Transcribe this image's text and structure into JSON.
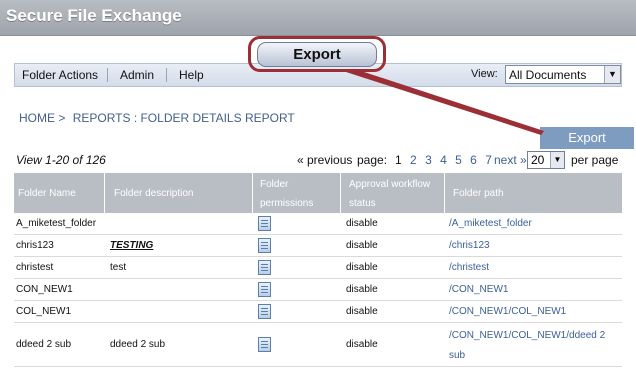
{
  "app": {
    "title": "Secure File Exchange"
  },
  "callout": {
    "label": "Export"
  },
  "menu": {
    "items": [
      {
        "label": "Folder Actions"
      },
      {
        "label": "Admin"
      },
      {
        "label": "Help"
      }
    ],
    "view_label": "View:",
    "view_selected": "All Documents"
  },
  "breadcrumb": {
    "home": "HOME >",
    "current": "REPORTS : FOLDER DETAILS REPORT"
  },
  "export_button": "Export",
  "pager": {
    "view_count": "View 1-20  of  126",
    "previous": "« previous",
    "page_label": "page:",
    "pages": [
      "1",
      "2",
      "3",
      "4",
      "5",
      "6",
      "7"
    ],
    "next": "next »",
    "per_page_value": "20",
    "per_page_label": "per page"
  },
  "table": {
    "columns": {
      "folder_name": "Folder Name",
      "folder_description": "Folder description",
      "folder_permissions_1": "Folder",
      "folder_permissions_2": "permissions",
      "approval_1": "Approval workflow",
      "approval_2": "status",
      "folder_path": "Folder path"
    },
    "rows": [
      {
        "name": "A_miketest_folder",
        "description": "",
        "status": "disable",
        "path": "/A_miketest_folder"
      },
      {
        "name": "chris123",
        "description": "TESTING",
        "status": "disable",
        "path": "/chris123"
      },
      {
        "name": "christest",
        "description": "test",
        "status": "disable",
        "path": "/christest"
      },
      {
        "name": "CON_NEW1",
        "description": "",
        "status": "disable",
        "path": "/CON_NEW1"
      },
      {
        "name": "COL_NEW1",
        "description": "",
        "status": "disable",
        "path": "/CON_NEW1/COL_NEW1"
      },
      {
        "name": "ddeed 2 sub",
        "description": "ddeed 2 sub",
        "status": "disable",
        "path": "/CON_NEW1/COL_NEW1/ddeed 2 sub"
      }
    ]
  },
  "colors": {
    "accent": "#9b2f35",
    "header_bg": "#b9bdc4",
    "link": "#3b5f97",
    "export_bg": "#7e9bc0"
  },
  "icons": {
    "permissions": "document-icon"
  }
}
